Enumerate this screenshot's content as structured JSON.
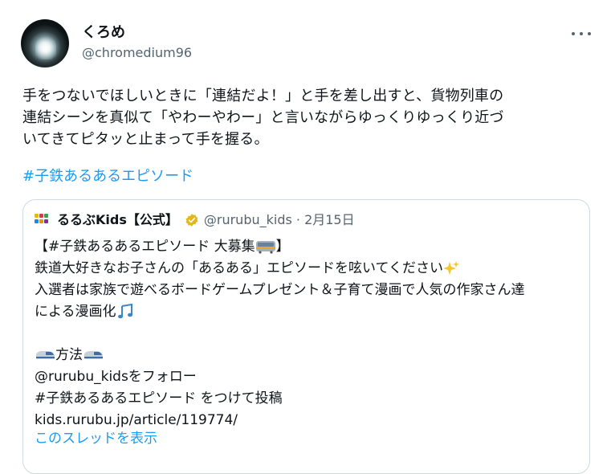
{
  "author": {
    "name": "くろめ",
    "handle": "@chromedium96"
  },
  "tweet": {
    "text": "手をつないでほしいときに「連結だよ！」と手を差し出すと、貨物列車の\n連結シーンを真似て「やわーやわー」と言いながらゆっくりゆっくり近づ\nいてきてピタッと止まって手を握る。",
    "hashtag": "#子鉄あるあるエピソード"
  },
  "quote": {
    "name": "るるぶKids【公式】",
    "meta": "@rurubu_kids · 2月15日",
    "lines": [
      "【#子鉄あるあるエピソード 大募集",
      "鉄道大好きなお子さんの「あるある」エピソードを呟いてください",
      "入選者は家族で遊べるボードゲームプレゼント＆子育て漫画で人気の作家さん達",
      "による漫画化",
      "",
      "方法",
      "@rurubu_kidsをフォロー",
      "#子鉄あるあるエピソード をつけて投稿",
      "kids.rurubu.jp/article/119774/"
    ],
    "line1_end": "】",
    "show_thread": "このスレッドを表示"
  },
  "colors": {
    "link": "#1d9bf0",
    "verified": "#e2b719",
    "muted": "#536471"
  },
  "icons": [
    "more-icon",
    "verified-icon",
    "train-emoji",
    "sparkles-emoji",
    "music-notes-emoji",
    "bullet-train-emoji"
  ]
}
